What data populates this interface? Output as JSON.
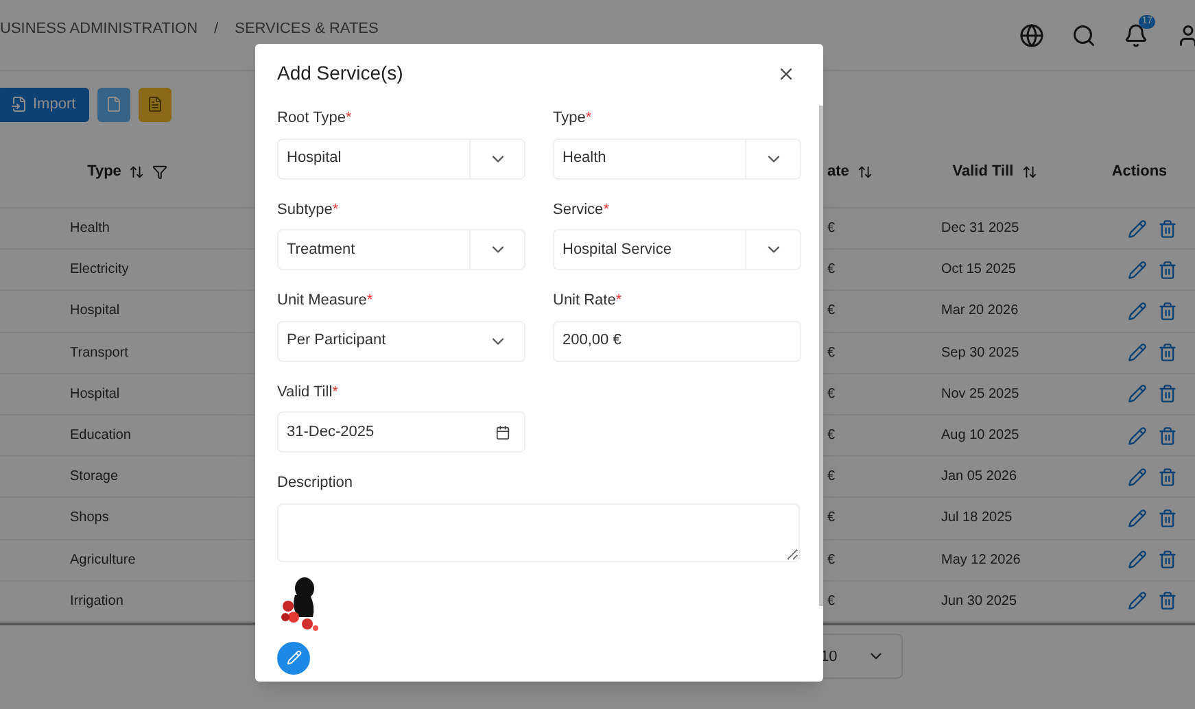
{
  "breadcrumb": {
    "parent": "USINESS ADMINISTRATION",
    "separator": "/",
    "current": "SERVICES & RATES"
  },
  "notifications": {
    "count": "17"
  },
  "toolbar": {
    "import_label": "Import"
  },
  "table": {
    "columns": [
      "Type",
      "ate",
      "Valid Till",
      "Actions"
    ],
    "rows": [
      {
        "type": "Health",
        "rate": "€",
        "valid_till": "Dec 31 2025"
      },
      {
        "type": "Electricity",
        "rate": "€",
        "valid_till": "Oct 15 2025"
      },
      {
        "type": "Hospital",
        "rate": "€",
        "valid_till": "Mar 20 2026"
      },
      {
        "type": "Transport",
        "rate": "€",
        "valid_till": "Sep 30 2025"
      },
      {
        "type": "Hospital",
        "rate": "€",
        "valid_till": "Nov 25 2025"
      },
      {
        "type": "Education",
        "rate": "€",
        "valid_till": "Aug 10 2025"
      },
      {
        "type": "Storage",
        "rate": "€",
        "valid_till": "Jan 05 2026"
      },
      {
        "type": "Shops",
        "rate": "€",
        "valid_till": "Jul 18 2025"
      },
      {
        "type": "Agriculture",
        "rate": "€",
        "valid_till": "May 12 2026"
      },
      {
        "type": "Irrigation",
        "rate": "€",
        "valid_till": "Jun 30 2025"
      }
    ]
  },
  "pagination": {
    "page_size": "10"
  },
  "dialog": {
    "title": "Add Service(s)",
    "fields": [
      {
        "kind": "select",
        "label": "Root Type",
        "mark": "*",
        "value": "Hospital"
      },
      {
        "kind": "select",
        "label": "Type",
        "mark": "*",
        "value": "Health"
      },
      {
        "kind": "select",
        "label": "Subtype",
        "mark": "*",
        "value": "Treatment"
      },
      {
        "kind": "select",
        "label": "Service",
        "mark": "*",
        "value": "Hospital Service"
      },
      {
        "kind": "plainselect",
        "label": "Unit Measure",
        "mark": "*",
        "value": "Per Participant"
      },
      {
        "kind": "text",
        "label": "Unit Rate",
        "mark": "*",
        "value": "200,00 €"
      },
      {
        "kind": "date",
        "label": "Valid Till",
        "mark": "*",
        "value": "31-Dec-2025"
      }
    ],
    "description": {
      "label": "Description"
    }
  }
}
